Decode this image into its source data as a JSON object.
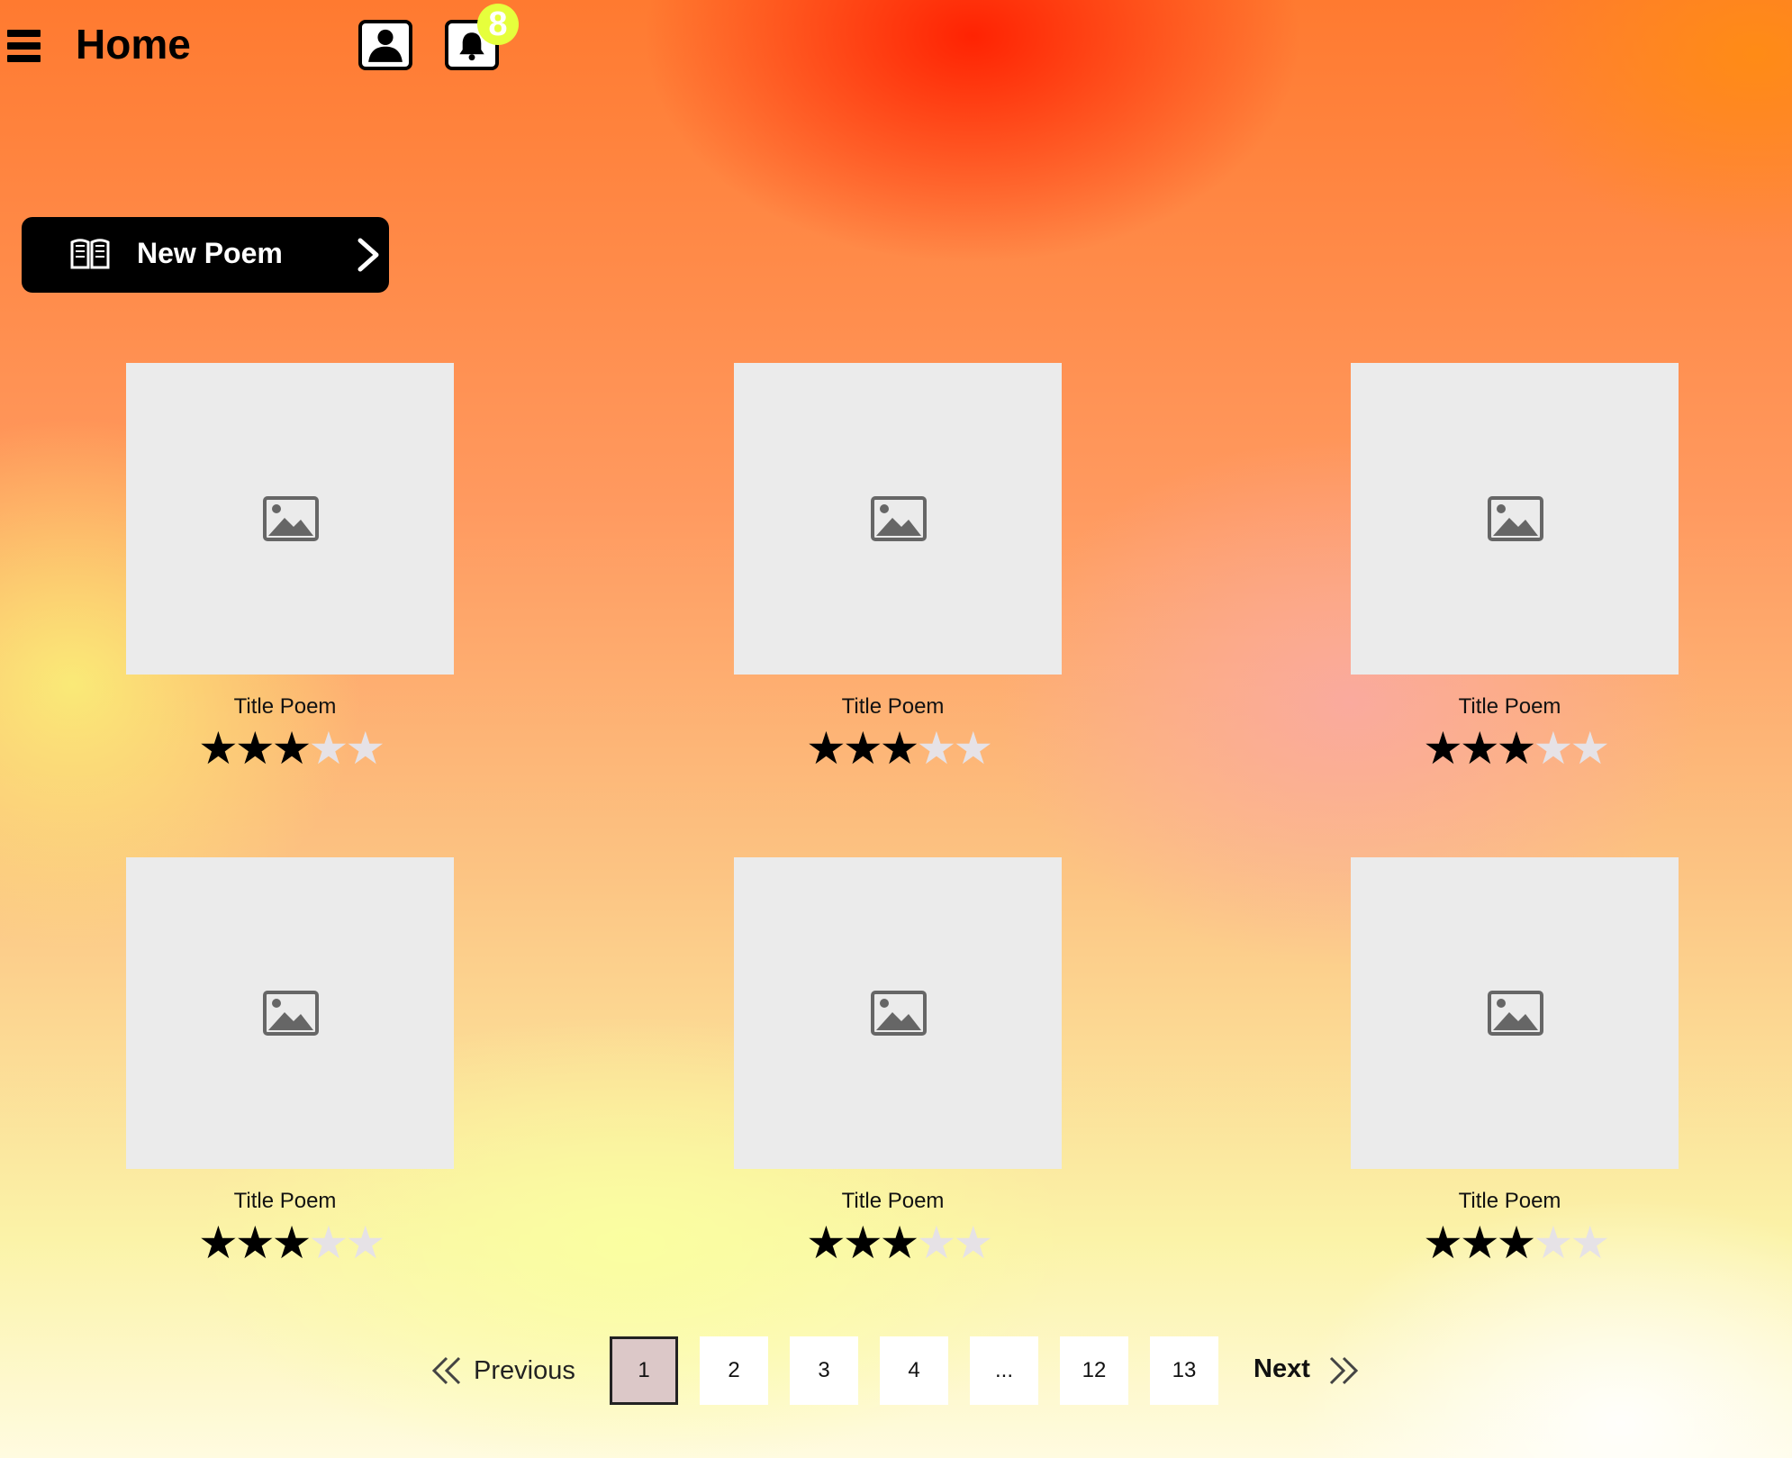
{
  "header": {
    "title": "Home",
    "notification_count": "8"
  },
  "actions": {
    "new_poem_label": "New Poem"
  },
  "poems": [
    {
      "title": "Title Poem",
      "rating": 3,
      "max_rating": 5
    },
    {
      "title": "Title Poem",
      "rating": 3,
      "max_rating": 5
    },
    {
      "title": "Title Poem",
      "rating": 3,
      "max_rating": 5
    },
    {
      "title": "Title Poem",
      "rating": 3,
      "max_rating": 5
    },
    {
      "title": "Title Poem",
      "rating": 3,
      "max_rating": 5
    },
    {
      "title": "Title Poem",
      "rating": 3,
      "max_rating": 5
    }
  ],
  "pagination": {
    "previous_label": "Previous",
    "next_label": "Next",
    "pages": [
      "1",
      "2",
      "3",
      "4",
      "...",
      "12",
      "13"
    ],
    "current": "1"
  },
  "colors": {
    "badge": "#e6ff3c",
    "active_page": "#dcc8c8",
    "placeholder": "#ebebeb",
    "star_on": "#000000",
    "star_off": "#e6e2e6"
  }
}
